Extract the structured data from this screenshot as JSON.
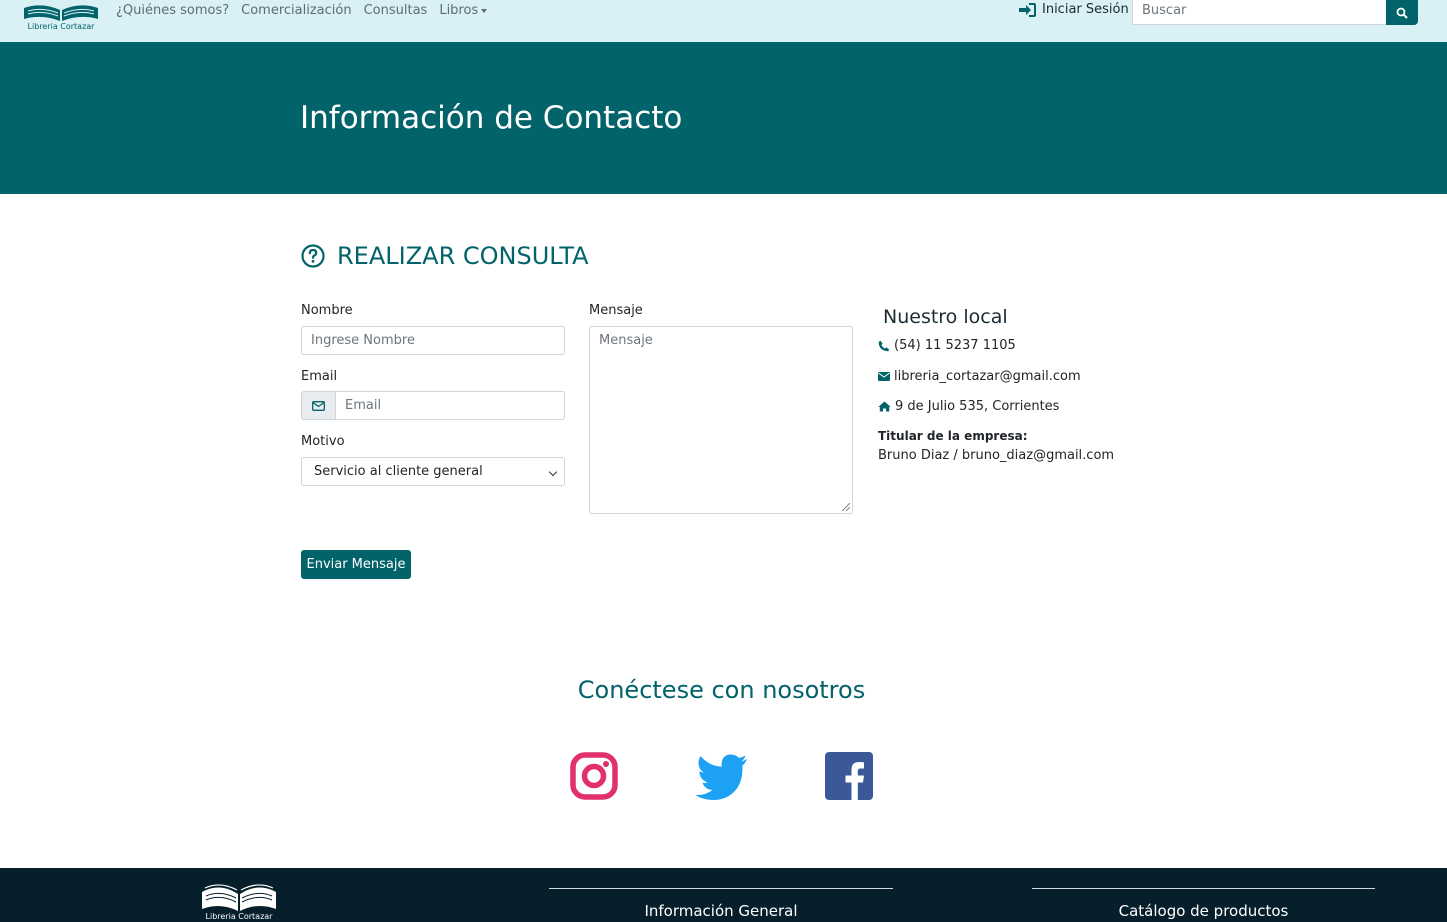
{
  "brand": {
    "name": "Libreria Cortazar"
  },
  "nav": {
    "links": [
      "¿Quiénes somos?",
      "Comercialización",
      "Consultas",
      "Libros"
    ],
    "login": "Iniciar Sesión",
    "search_placeholder": "Buscar"
  },
  "hero": {
    "title": "Información de Contacto"
  },
  "form": {
    "section_title": "REALIZAR CONSULTA",
    "name_label": "Nombre",
    "name_placeholder": "Ingrese Nombre",
    "email_label": "Email",
    "email_placeholder": "Email",
    "reason_label": "Motivo",
    "reason_selected": "Servicio al cliente general",
    "message_label": "Mensaje",
    "message_placeholder": "Mensaje",
    "submit": "Enviar Mensaje"
  },
  "local": {
    "title": "Nuestro local",
    "phone": "(54) 11 5237 1105",
    "email": "libreria_cortazar@gmail.com",
    "address": "9 de Julio 535, Corrientes",
    "owner_label": "Titular de la empresa:",
    "owner_value": "Bruno Diaz / bruno_diaz@gmail.com"
  },
  "social": {
    "title": "Conéctese con nosotros",
    "colors": {
      "instagram": "#e1306c",
      "twitter": "#1da1f2",
      "facebook": "#3b5998"
    }
  },
  "footer": {
    "brand": "Libreria Cortazar",
    "col1_title": "Información General",
    "col2_title": "Catálogo de productos"
  },
  "colors": {
    "primary": "#02636a",
    "navbar_bg": "#d9f1f4",
    "footer_bg": "#071f2b"
  }
}
